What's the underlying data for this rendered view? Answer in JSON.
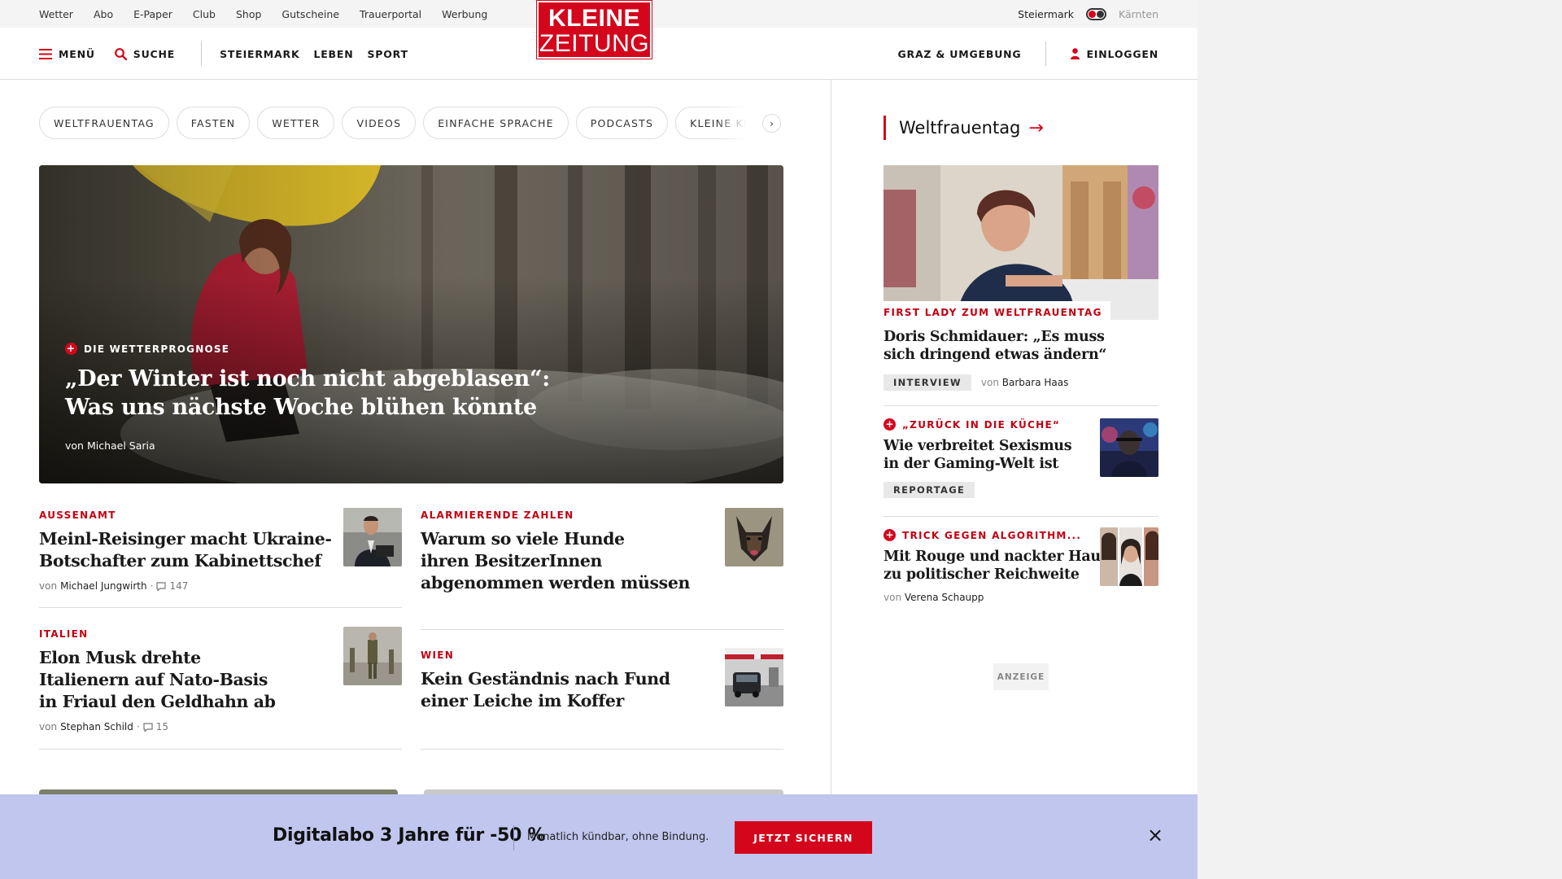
{
  "topbar": {
    "links": [
      "Wetter",
      "Abo",
      "E-Paper",
      "Club",
      "Shop",
      "Gutscheine",
      "Trauerportal",
      "Werbung"
    ],
    "region_active": "Steiermark",
    "region_inactive": "Kärnten"
  },
  "nav": {
    "menu_label": "MENÜ",
    "search_label": "SUCHE",
    "sections": [
      "STEIERMARK",
      "LEBEN",
      "SPORT"
    ],
    "location": "GRAZ & UMGEBUNG",
    "login_label": "EINLOGGEN"
  },
  "logo": {
    "line1": "KLEINE",
    "line2": "ZEITUNG"
  },
  "chips": [
    "WELTFRAUENTAG",
    "FASTEN",
    "WETTER",
    "VIDEOS",
    "EINFACHE SPRACHE",
    "PODCASTS",
    "KLEINE KINDERZEITUNG"
  ],
  "hero": {
    "kicker": "DIE WETTERPROGNOSE",
    "title_line1": "„Der Winter ist noch nicht abgeblasen“:",
    "title_line2": "Was uns nächste Woche blühen könnte",
    "author": "von Michael Saria"
  },
  "articles": [
    {
      "kicker": "AUSSENAMT",
      "title_lines": [
        "Meinl-Reisinger macht Ukraine-",
        "Botschafter zum Kabinettschef"
      ],
      "author": "Michael Jungwirth",
      "comments": "147"
    },
    {
      "kicker": "ALARMIERENDE ZAHLEN",
      "title_lines": [
        "Warum so viele Hunde",
        "ihren BesitzerInnen",
        "abgenommen werden müssen"
      ]
    },
    {
      "kicker": "ITALIEN",
      "title_lines": [
        "Elon Musk drehte",
        "Italienern auf Nato-Basis",
        "in Friaul den Geldhahn ab"
      ],
      "author": "Stephan Schild",
      "comments": "15"
    },
    {
      "kicker": "WIEN",
      "title_lines": [
        "Kein Geständnis nach Fund",
        "einer Leiche im Koffer"
      ]
    }
  ],
  "sidebar": {
    "heading": "Weltfrauentag",
    "featured": {
      "kicker": "FIRST LADY ZUM WELTFRAUENTAG",
      "title_lines": [
        "Doris Schmidauer: „Es muss",
        "sich dringend etwas ändern“"
      ],
      "badge": "INTERVIEW",
      "by": "von",
      "author": "Barbara Haas"
    },
    "items": [
      {
        "kicker": "„ZURÜCK IN DIE KÜCHE“",
        "title_lines": [
          "Wie verbreitet Sexismus",
          "in der Gaming-Welt ist"
        ],
        "badge": "REPORTAGE"
      },
      {
        "kicker": "TRICK GEGEN ALGORITHM...",
        "title_lines": [
          "Mit Rouge und nackter Haut",
          "zu politischer Reichweite"
        ],
        "by": "von",
        "author": "Verena Schaupp"
      }
    ],
    "ad_label": "ANZEIGE"
  },
  "banner": {
    "title": "Digitalabo 3 Jahre für -50 %",
    "subtitle": "Monatlich kündbar, ohne Bindung.",
    "cta": "JETZT SICHERN"
  },
  "colors": {
    "brand_red": "#d4061c",
    "banner_bg": "#c0c6ee"
  }
}
